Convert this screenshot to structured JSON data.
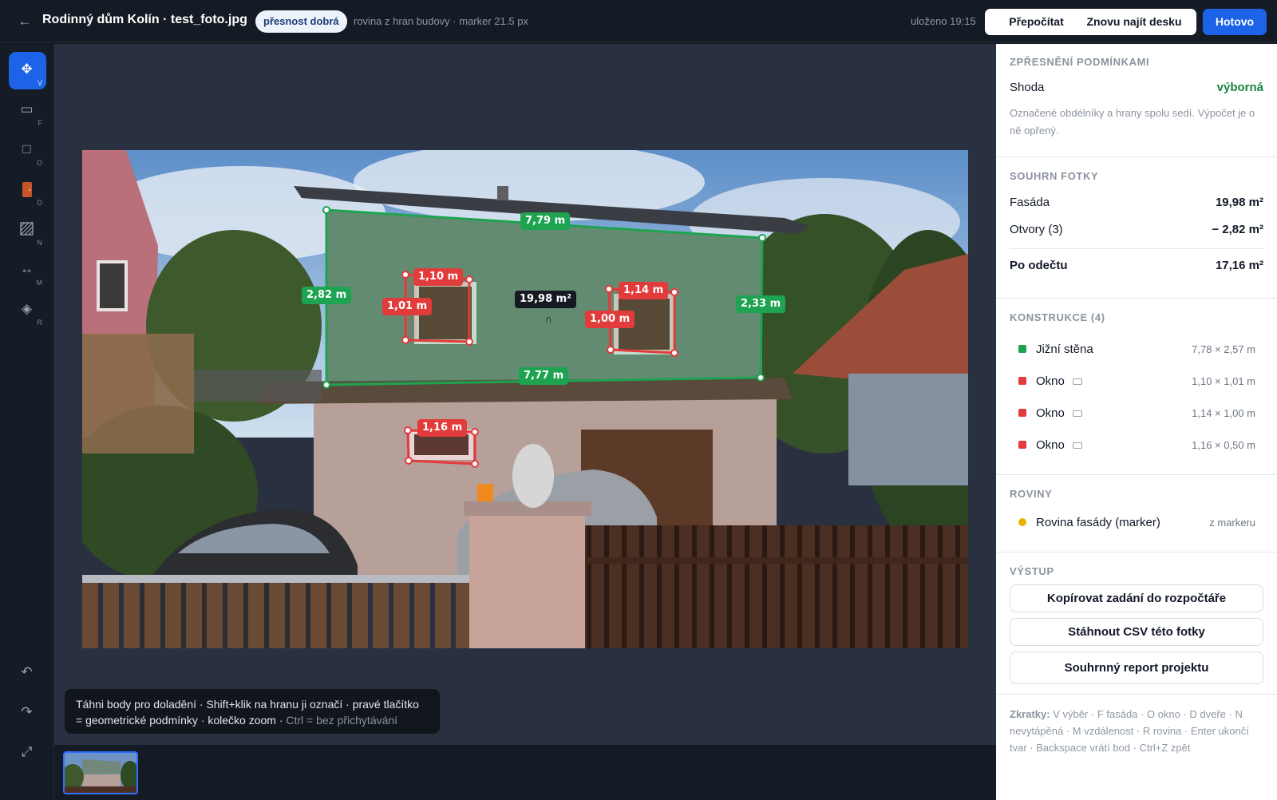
{
  "header": {
    "back_icon": "arrow-left-icon",
    "title": "Rodinný dům Kolín · test_foto.jpg",
    "badge": "přesnost dobrá",
    "subinfo": "rovina z hran budovy · marker 21.5 px",
    "saved": "uloženo 19:15",
    "recalc_label": "Přepočítat",
    "refind_label": "Znovu najít desku",
    "done_label": "Hotovo"
  },
  "tools": [
    {
      "name": "move",
      "key": "V",
      "icon": "move-icon",
      "active": true
    },
    {
      "name": "facade",
      "key": "F",
      "icon": "rectangle-icon"
    },
    {
      "name": "window",
      "key": "O",
      "icon": "square-icon"
    },
    {
      "name": "door",
      "key": "D",
      "icon": "door-icon"
    },
    {
      "name": "no-paint",
      "key": "N",
      "icon": "hatch-icon"
    },
    {
      "name": "distance",
      "key": "M",
      "icon": "arrows-horizontal-icon"
    },
    {
      "name": "plane",
      "key": "R",
      "icon": "diamond-icon"
    }
  ],
  "bottom_tools": [
    "undo-icon",
    "redo-icon",
    "fullscreen-icon"
  ],
  "annotations": {
    "facade_top": "7,79 m",
    "facade_bottom": "7,77 m",
    "facade_left": "2,82 m",
    "facade_right": "2,33 m",
    "facade_area": "19,98 m²",
    "win1_w": "1,10 m",
    "win1_h": "1,01 m",
    "win2_w": "1,14 m",
    "win2_h": "1,00 m",
    "win3_w": "1,16 m"
  },
  "hint": {
    "main": "Táhni body pro doladění · Shift+klik na hranu ji označí · pravé tlačítko = geometrické podmínky · kolečko zoom · ",
    "dim": "Ctrl = bez přichytávání"
  },
  "panel": {
    "refine": {
      "heading": "ZPŘESNĚNÍ PODMÍNKAMI",
      "match_label": "Shoda",
      "match_value": "výborná",
      "note": "Označené obdélníky a hrany spolu sedí. Výpočet je o ně opřený."
    },
    "summary": {
      "heading": "SOUHRN FOTKY",
      "facade_label": "Fasáda",
      "facade_value": "19,98 m²",
      "openings_label": "Otvory (3)",
      "openings_value": "− 2,82 m²",
      "net_label": "Po odečtu",
      "net_value": "17,16 m²"
    },
    "constructions": {
      "heading": "KONSTRUKCE (4)",
      "items": [
        {
          "name": "Jižní stěna",
          "dims": "7,78 × 2,57 m",
          "color": "#1ea350",
          "icon": ""
        },
        {
          "name": "Okno",
          "dims": "1,10 × 1,01 m",
          "color": "#e23b3b",
          "icon": "rectangle-icon"
        },
        {
          "name": "Okno",
          "dims": "1,14 × 1,00 m",
          "color": "#e23b3b",
          "icon": "rectangle-icon"
        },
        {
          "name": "Okno",
          "dims": "1,16 × 0,50 m",
          "color": "#e23b3b",
          "icon": "rectangle-icon"
        }
      ]
    },
    "planes": {
      "heading": "ROVINY",
      "items": [
        {
          "name": "Rovina fasády (marker)",
          "source": "z markeru",
          "color": "#e6b400"
        }
      ]
    },
    "output": {
      "heading": "VÝSTUP",
      "copy_label": "Kopírovat zadání do rozpočtáře",
      "csv_label": "Stáhnout CSV této fotky",
      "report_label": "Souhrnný report projektu"
    },
    "shortcuts": {
      "label": "Zkratky:",
      "text": " V výběr · F fasáda · O okno · D dveře · N nevytápěná · M vzdálenost · R rovina · Enter ukončí tvar · Backspace vrátí bod · Ctrl+Z zpět"
    }
  },
  "colors": {
    "accent": "#1d63e8",
    "facade_green": "#1ea350",
    "opening_red": "#e23b3b",
    "plane_yellow": "#e6b400"
  }
}
